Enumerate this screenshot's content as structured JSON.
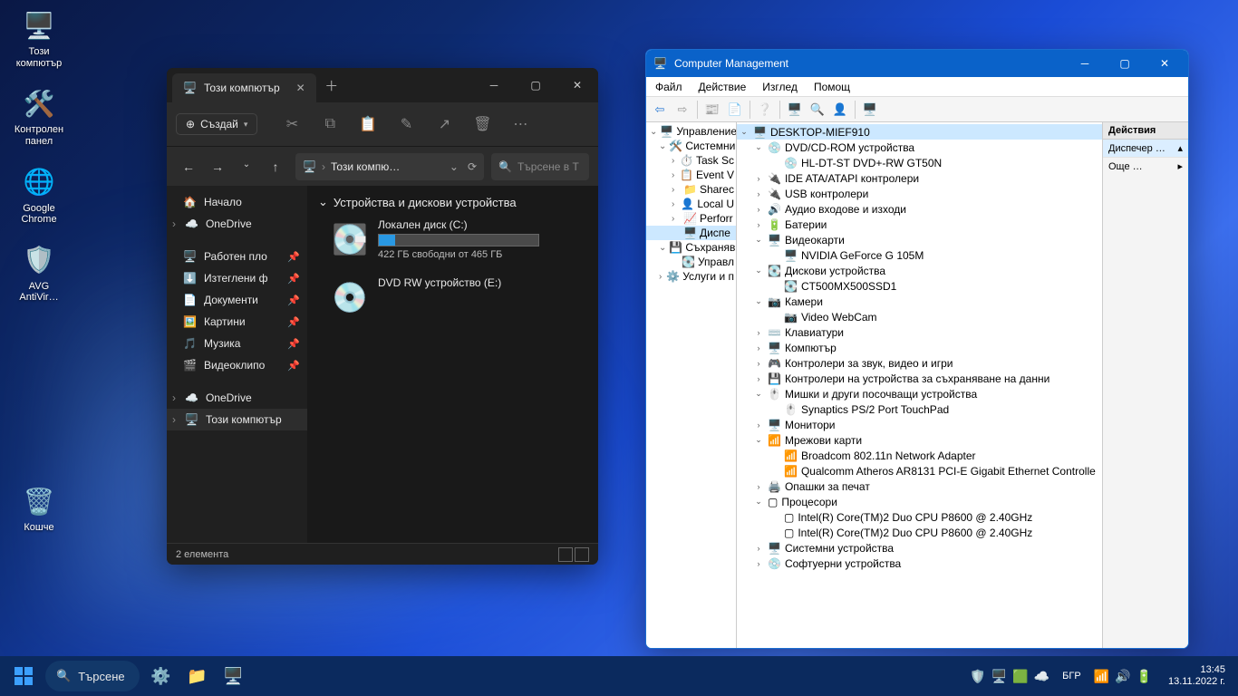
{
  "desktop": {
    "icons": [
      {
        "label": "Този\nкомпютър",
        "glyph": "🖥️"
      },
      {
        "label": "Контролен\nпанел",
        "glyph": "🛠️"
      },
      {
        "label": "Google\nChrome",
        "glyph": "🌐"
      },
      {
        "label": "AVG\nAntiVir…",
        "glyph": "🛡️"
      },
      {
        "label": "Кошче",
        "glyph": "🗑️"
      }
    ]
  },
  "explorer": {
    "tab_title": "Този компютър",
    "new_label": "Създай",
    "path_label": "Този компю…",
    "search_placeholder": "Търсене в Т",
    "sidebar": {
      "home": "Начало",
      "onedrive": "OneDrive",
      "pinned": [
        "Работен пло",
        "Изтеглени ф",
        "Документи",
        "Картини",
        "Музика",
        "Видеоклипо"
      ],
      "onedrive2": "OneDrive",
      "thispc": "Този компютър"
    },
    "group_header": "Устройства и дискови устройства",
    "drives": [
      {
        "name": "Локален диск (C:)",
        "sub": "422 ГБ свободни от 465 ГБ",
        "fill_pct": 10
      },
      {
        "name": "DVD RW устройство (E:)",
        "sub": "",
        "fill_pct": null
      }
    ],
    "status": "2 елемента"
  },
  "cm": {
    "title": "Computer Management",
    "menu": [
      "Файл",
      "Действие",
      "Изглед",
      "Помощ"
    ],
    "left_tree": [
      {
        "label": "Управление н",
        "depth": 0,
        "exp": "v",
        "icon": "🖥️"
      },
      {
        "label": "Системни",
        "depth": 1,
        "exp": "v",
        "icon": "🛠️"
      },
      {
        "label": "Task Sc",
        "depth": 2,
        "exp": ">",
        "icon": "⏱️"
      },
      {
        "label": "Event V",
        "depth": 2,
        "exp": ">",
        "icon": "📋"
      },
      {
        "label": "Sharec",
        "depth": 2,
        "exp": ">",
        "icon": "📁"
      },
      {
        "label": "Local U",
        "depth": 2,
        "exp": ">",
        "icon": "👤"
      },
      {
        "label": "Perforr",
        "depth": 2,
        "exp": ">",
        "icon": "📈"
      },
      {
        "label": "Диспе",
        "depth": 2,
        "exp": "",
        "icon": "🖥️",
        "sel": true
      },
      {
        "label": "Съхраняв",
        "depth": 1,
        "exp": "v",
        "icon": "💾"
      },
      {
        "label": "Управл",
        "depth": 2,
        "exp": "",
        "icon": "💽"
      },
      {
        "label": "Услуги и п",
        "depth": 1,
        "exp": ">",
        "icon": "⚙️"
      }
    ],
    "dev_tree": [
      {
        "label": "DESKTOP-MIEF910",
        "depth": 0,
        "exp": "v",
        "icon": "🖥️",
        "sel": true
      },
      {
        "label": "DVD/CD-ROM устройства",
        "depth": 1,
        "exp": "v",
        "icon": "💿"
      },
      {
        "label": "HL-DT-ST DVD+-RW GT50N",
        "depth": 2,
        "exp": "",
        "icon": "💿"
      },
      {
        "label": "IDE ATA/ATAPI контролери",
        "depth": 1,
        "exp": ">",
        "icon": "🔌"
      },
      {
        "label": "USB контролери",
        "depth": 1,
        "exp": ">",
        "icon": "🔌"
      },
      {
        "label": "Аудио входове и изходи",
        "depth": 1,
        "exp": ">",
        "icon": "🔊"
      },
      {
        "label": "Батерии",
        "depth": 1,
        "exp": ">",
        "icon": "🔋"
      },
      {
        "label": "Видеокарти",
        "depth": 1,
        "exp": "v",
        "icon": "🖥️"
      },
      {
        "label": "NVIDIA GeForce G 105M",
        "depth": 2,
        "exp": "",
        "icon": "🖥️"
      },
      {
        "label": "Дискови устройства",
        "depth": 1,
        "exp": "v",
        "icon": "💽"
      },
      {
        "label": "CT500MX500SSD1",
        "depth": 2,
        "exp": "",
        "icon": "💽"
      },
      {
        "label": "Камери",
        "depth": 1,
        "exp": "v",
        "icon": "📷"
      },
      {
        "label": "Video WebCam",
        "depth": 2,
        "exp": "",
        "icon": "📷"
      },
      {
        "label": "Клавиатури",
        "depth": 1,
        "exp": ">",
        "icon": "⌨️"
      },
      {
        "label": "Компютър",
        "depth": 1,
        "exp": ">",
        "icon": "🖥️"
      },
      {
        "label": "Контролери за звук, видео и игри",
        "depth": 1,
        "exp": ">",
        "icon": "🎮"
      },
      {
        "label": "Контролери на устройства за съхраняване на данни",
        "depth": 1,
        "exp": ">",
        "icon": "💾"
      },
      {
        "label": "Мишки и други посочващи устройства",
        "depth": 1,
        "exp": "v",
        "icon": "🖱️"
      },
      {
        "label": "Synaptics PS/2 Port TouchPad",
        "depth": 2,
        "exp": "",
        "icon": "🖱️"
      },
      {
        "label": "Монитори",
        "depth": 1,
        "exp": ">",
        "icon": "🖥️"
      },
      {
        "label": "Мрежови карти",
        "depth": 1,
        "exp": "v",
        "icon": "📶"
      },
      {
        "label": "Broadcom 802.11n Network Adapter",
        "depth": 2,
        "exp": "",
        "icon": "📶"
      },
      {
        "label": "Qualcomm Atheros AR8131 PCI-E Gigabit Ethernet Controlle",
        "depth": 2,
        "exp": "",
        "icon": "📶"
      },
      {
        "label": "Опашки за печат",
        "depth": 1,
        "exp": ">",
        "icon": "🖨️"
      },
      {
        "label": "Процесори",
        "depth": 1,
        "exp": "v",
        "icon": "▢"
      },
      {
        "label": "Intel(R) Core(TM)2 Duo CPU     P8600  @ 2.40GHz",
        "depth": 2,
        "exp": "",
        "icon": "▢"
      },
      {
        "label": "Intel(R) Core(TM)2 Duo CPU     P8600  @ 2.40GHz",
        "depth": 2,
        "exp": "",
        "icon": "▢"
      },
      {
        "label": "Системни устройства",
        "depth": 1,
        "exp": ">",
        "icon": "🖥️"
      },
      {
        "label": "Софтуерни устройства",
        "depth": 1,
        "exp": ">",
        "icon": "💿"
      }
    ],
    "actions": {
      "header": "Действия",
      "item1": "Диспечер …",
      "item2": "Още …"
    }
  },
  "taskbar": {
    "search": "Търсене",
    "lang": "БГР",
    "time": "13:45",
    "date": "13.11.2022 г."
  }
}
